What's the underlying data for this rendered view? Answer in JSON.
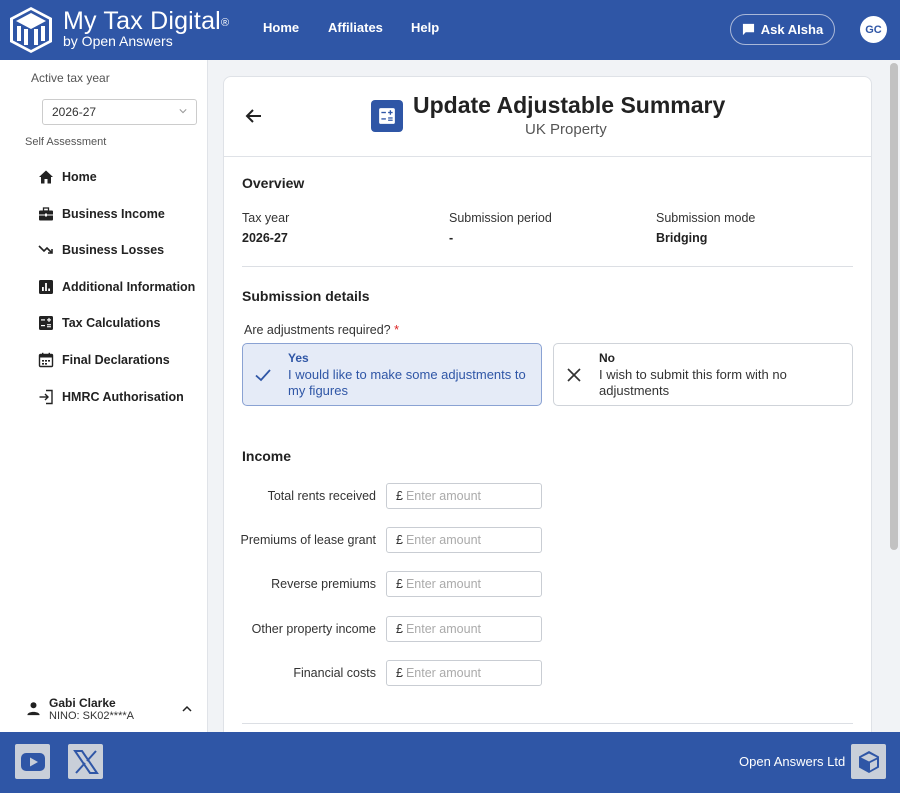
{
  "header": {
    "brand_title": "My Tax Digital",
    "brand_registered": "®",
    "brand_sub": "by Open Answers",
    "nav": [
      "Home",
      "Affiliates",
      "Help"
    ],
    "ask_label": "Ask AIsha",
    "avatar_initials": "GC",
    "bg_color": "#2f56a6"
  },
  "sidebar": {
    "active_year_label": "Active tax year",
    "year_value": "2026-27",
    "section_label": "Self Assessment",
    "items": [
      {
        "label": "Home",
        "icon": "home-icon"
      },
      {
        "label": "Business Income",
        "icon": "briefcase-icon"
      },
      {
        "label": "Business Losses",
        "icon": "trending-down-icon"
      },
      {
        "label": "Additional Information",
        "icon": "bar-chart-icon"
      },
      {
        "label": "Tax Calculations",
        "icon": "calculator-icon"
      },
      {
        "label": "Final Declarations",
        "icon": "calendar-icon"
      },
      {
        "label": "HMRC Authorisation",
        "icon": "login-icon"
      }
    ],
    "user": {
      "name": "Gabi Clarke",
      "nino": "NINO: SK02****A"
    }
  },
  "card": {
    "title": "Update Adjustable Summary",
    "subtitle": "UK Property",
    "overview": {
      "heading": "Overview",
      "fields": [
        {
          "label": "Tax year",
          "value": "2026-27"
        },
        {
          "label": "Submission period",
          "value": "-"
        },
        {
          "label": "Submission mode",
          "value": "Bridging"
        }
      ]
    },
    "submission": {
      "heading": "Submission details",
      "question": "Are adjustments required?",
      "required_mark": "*",
      "yes_title": "Yes",
      "yes_desc": "I would like to make some adjustments to my figures",
      "no_title": "No",
      "no_desc": "I wish to submit this form with no adjustments",
      "selected": "Yes"
    },
    "income": {
      "heading": "Income",
      "currency": "£",
      "placeholder": "Enter amount",
      "fields": [
        "Total rents received",
        "Premiums of lease grant",
        "Reverse premiums",
        "Other property income",
        "Financial costs"
      ]
    }
  },
  "footer": {
    "company": "Open Answers Ltd"
  }
}
